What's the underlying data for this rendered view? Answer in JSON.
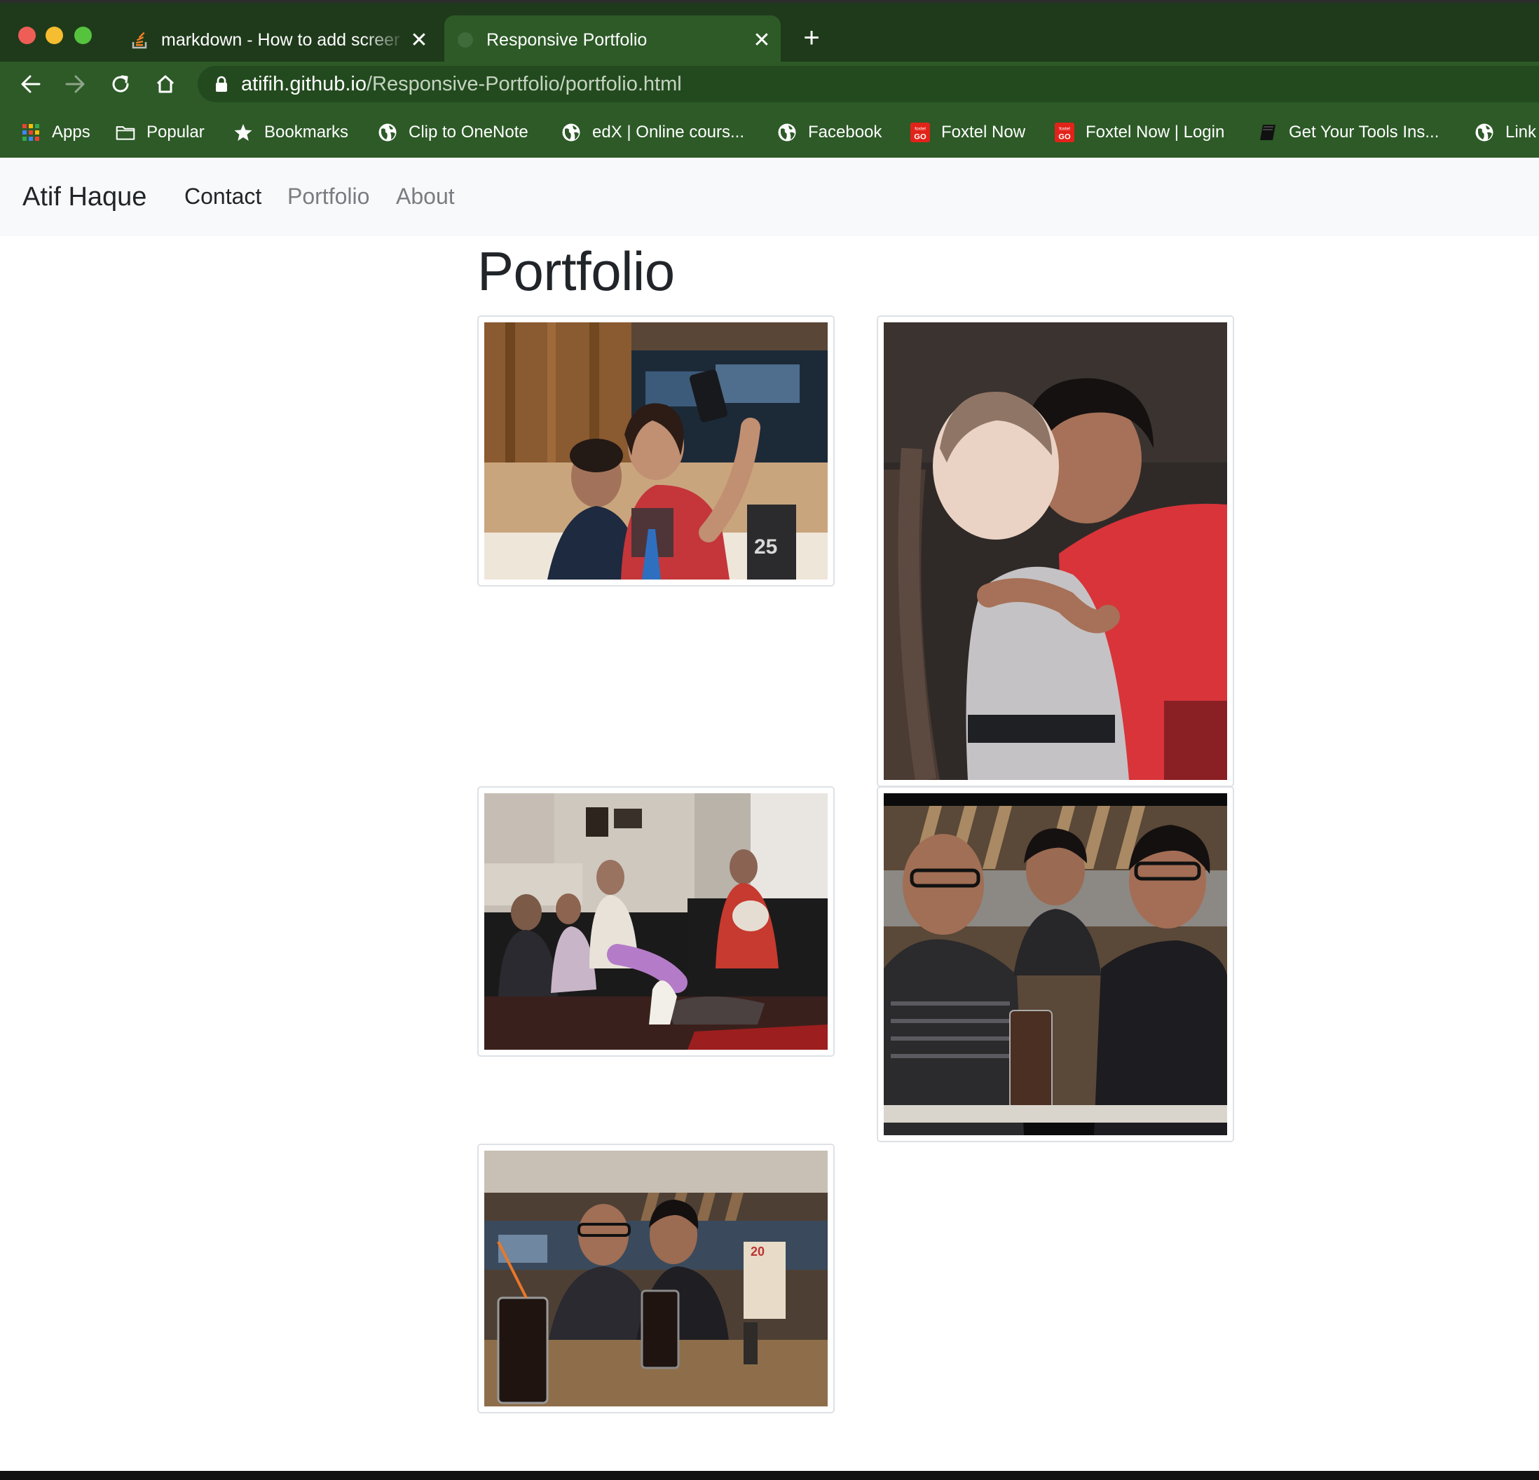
{
  "browser": {
    "tabs": [
      {
        "title": "markdown - How to add screer",
        "active": false,
        "favicon": "stackoverflow-icon"
      },
      {
        "title": "Responsive Portfolio",
        "active": true,
        "favicon": "globe-icon"
      }
    ],
    "new_tab_label": "+",
    "close_glyph": "✕",
    "url": {
      "host": "atifih.github.io",
      "path": "/Responsive-Portfolio/portfolio.html"
    },
    "bookmarks": [
      {
        "label": "Apps",
        "icon": "apps-grid-icon"
      },
      {
        "label": "Popular",
        "icon": "folder-icon"
      },
      {
        "label": "Bookmarks",
        "icon": "star-icon"
      },
      {
        "label": "Clip to OneNote",
        "icon": "globe-icon"
      },
      {
        "label": "edX | Online cours...",
        "icon": "globe-icon"
      },
      {
        "label": "Facebook",
        "icon": "globe-icon"
      },
      {
        "label": "Foxtel Now",
        "icon": "foxtel-go-icon"
      },
      {
        "label": "Foxtel Now | Login",
        "icon": "foxtel-go-icon"
      },
      {
        "label": "Get Your Tools Ins...",
        "icon": "book-icon"
      },
      {
        "label": "Link",
        "icon": "globe-icon"
      }
    ],
    "colors": {
      "chrome": "#2d5a27",
      "tabstrip": "#1f3a1b"
    }
  },
  "site": {
    "brand": "Atif Haque",
    "nav": [
      {
        "label": "Contact",
        "active": true
      },
      {
        "label": "Portfolio",
        "active": false
      },
      {
        "label": "About",
        "active": false
      }
    ],
    "page_title": "Portfolio",
    "photos": [
      {
        "subject": "selfie of a mother and son in a restaurant booth"
      },
      {
        "subject": "boy hugging a baby on a leather sofa"
      },
      {
        "subject": "family seated on black leather sofas in a living room"
      },
      {
        "subject": "three people posing in a restaurant"
      },
      {
        "subject": "two men at a restaurant table with drinks"
      }
    ]
  }
}
